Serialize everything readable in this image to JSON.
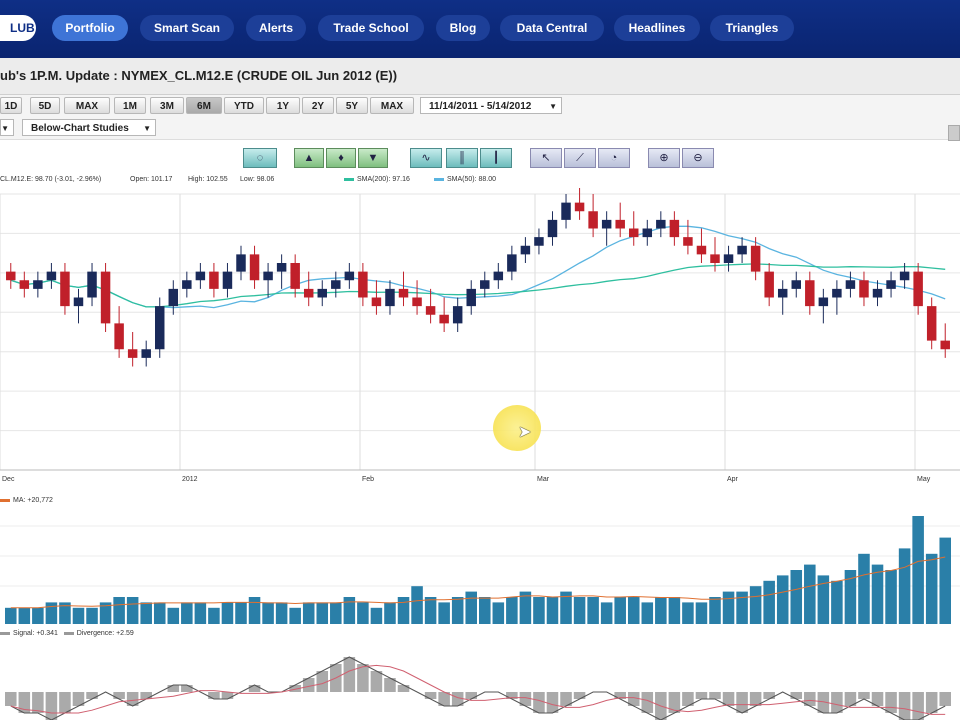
{
  "nav": {
    "logo": "LUB",
    "items": [
      "Portfolio",
      "Smart Scan",
      "Alerts",
      "Trade School",
      "Blog",
      "Data Central",
      "Headlines",
      "Triangles"
    ],
    "active": "Portfolio"
  },
  "title": "ub's 1P.M. Update  : NYMEX_CL.M12.E (CRUDE OIL Jun 2012 (E))",
  "toolbar": {
    "range_buttons_a": [
      "1D",
      "5D",
      "MAX"
    ],
    "range_buttons_b": [
      "1M",
      "3M",
      "6M",
      "YTD",
      "1Y",
      "2Y",
      "5Y",
      "MAX"
    ],
    "selected_range": "6M",
    "date_range": "11/14/2011 - 5/14/2012",
    "below_chart_studies": "Below-Chart Studies"
  },
  "legend": {
    "symbol_quote": "CL.M12.E: 98.70 (-3.01, -2.96%)",
    "open": "Open: 101.17",
    "high": "High: 102.55",
    "low": "Low: 98.06",
    "sma200": "SMA(200): 97.16",
    "sma50": "SMA(50): 88.00",
    "colors": {
      "sma200": "#2fbf9f",
      "sma50": "#5ab4e0",
      "up": "#1a2a5a",
      "down": "#c0202a",
      "volume": "#2a7fa8"
    }
  },
  "x_axis": [
    "Dec",
    "2012",
    "Feb",
    "Mar",
    "Apr",
    "May"
  ],
  "volume_legend": "MA: +20,772",
  "macd_legend": {
    "signal": "Signal: +0.341",
    "divergence": "Divergence: +2.59"
  },
  "chart_data": {
    "type": "candlestick",
    "ylim": [
      80,
      112
    ],
    "candles": [
      [
        103,
        104,
        101,
        102
      ],
      [
        102,
        103,
        100,
        101
      ],
      [
        101,
        103,
        100,
        102
      ],
      [
        102,
        104,
        101,
        103
      ],
      [
        103,
        104,
        98,
        99
      ],
      [
        99,
        101,
        97,
        100
      ],
      [
        100,
        104,
        99,
        103
      ],
      [
        103,
        104,
        96,
        97
      ],
      [
        97,
        99,
        93,
        94
      ],
      [
        94,
        96,
        92,
        93
      ],
      [
        93,
        95,
        92,
        94
      ],
      [
        94,
        100,
        93,
        99
      ],
      [
        99,
        102,
        98,
        101
      ],
      [
        101,
        103,
        100,
        102
      ],
      [
        102,
        104,
        101,
        103
      ],
      [
        103,
        104,
        100,
        101
      ],
      [
        101,
        104,
        100,
        103
      ],
      [
        103,
        106,
        102,
        105
      ],
      [
        105,
        106,
        101,
        102
      ],
      [
        102,
        104,
        100,
        103
      ],
      [
        103,
        105,
        101,
        104
      ],
      [
        104,
        105,
        100,
        101
      ],
      [
        101,
        103,
        99,
        100
      ],
      [
        100,
        102,
        99,
        101
      ],
      [
        101,
        103,
        100,
        102
      ],
      [
        102,
        104,
        101,
        103
      ],
      [
        103,
        104,
        99,
        100
      ],
      [
        100,
        102,
        98,
        99
      ],
      [
        99,
        102,
        98,
        101
      ],
      [
        101,
        103,
        99,
        100
      ],
      [
        100,
        102,
        98,
        99
      ],
      [
        99,
        101,
        97,
        98
      ],
      [
        98,
        100,
        96,
        97
      ],
      [
        97,
        100,
        96,
        99
      ],
      [
        99,
        102,
        98,
        101
      ],
      [
        101,
        103,
        100,
        102
      ],
      [
        102,
        104,
        101,
        103
      ],
      [
        103,
        106,
        102,
        105
      ],
      [
        105,
        107,
        104,
        106
      ],
      [
        106,
        108,
        105,
        107
      ],
      [
        107,
        110,
        106,
        109
      ],
      [
        109,
        112,
        108,
        111
      ],
      [
        111,
        113,
        109,
        110
      ],
      [
        110,
        112,
        107,
        108
      ],
      [
        108,
        110,
        106,
        109
      ],
      [
        109,
        111,
        107,
        108
      ],
      [
        108,
        110,
        106,
        107
      ],
      [
        107,
        109,
        106,
        108
      ],
      [
        108,
        110,
        107,
        109
      ],
      [
        109,
        110,
        106,
        107
      ],
      [
        107,
        109,
        105,
        106
      ],
      [
        106,
        108,
        104,
        105
      ],
      [
        105,
        107,
        103,
        104
      ],
      [
        104,
        106,
        103,
        105
      ],
      [
        105,
        107,
        104,
        106
      ],
      [
        106,
        107,
        102,
        103
      ],
      [
        103,
        104,
        99,
        100
      ],
      [
        100,
        102,
        98,
        101
      ],
      [
        101,
        103,
        100,
        102
      ],
      [
        102,
        103,
        98,
        99
      ],
      [
        99,
        101,
        97,
        100
      ],
      [
        100,
        102,
        98,
        101
      ],
      [
        101,
        103,
        100,
        102
      ],
      [
        102,
        103,
        99,
        100
      ],
      [
        100,
        102,
        99,
        101
      ],
      [
        101,
        103,
        100,
        102
      ],
      [
        102,
        104,
        101,
        103
      ],
      [
        103,
        104,
        98,
        99
      ],
      [
        99,
        100,
        94,
        95
      ],
      [
        95,
        97,
        93,
        94
      ]
    ],
    "volume": [
      3,
      3,
      3,
      4,
      4,
      3,
      3,
      4,
      5,
      5,
      4,
      4,
      3,
      4,
      4,
      3,
      4,
      4,
      5,
      4,
      4,
      3,
      4,
      4,
      4,
      5,
      4,
      3,
      4,
      5,
      7,
      5,
      4,
      5,
      6,
      5,
      4,
      5,
      6,
      5,
      5,
      6,
      5,
      5,
      4,
      5,
      5,
      4,
      5,
      5,
      4,
      4,
      5,
      6,
      6,
      7,
      8,
      9,
      10,
      11,
      9,
      8,
      10,
      13,
      11,
      10,
      14,
      20,
      13,
      16
    ],
    "macd": [
      -2,
      -3,
      -3,
      -4,
      -3,
      -2,
      -1,
      0,
      -1,
      -2,
      -1,
      0,
      1,
      1,
      0,
      -1,
      -1,
      0,
      1,
      0,
      0,
      1,
      2,
      3,
      4,
      5,
      4,
      3,
      2,
      1,
      0,
      -1,
      -2,
      -2,
      -1,
      0,
      0,
      -1,
      -2,
      -3,
      -3,
      -2,
      -1,
      0,
      0,
      -1,
      -2,
      -3,
      -4,
      -3,
      -2,
      -1,
      -1,
      -2,
      -3,
      -2,
      -1,
      0,
      -1,
      -2,
      -3,
      -3,
      -2,
      -1,
      -2,
      -3,
      -4,
      -4,
      -3,
      -2
    ]
  }
}
